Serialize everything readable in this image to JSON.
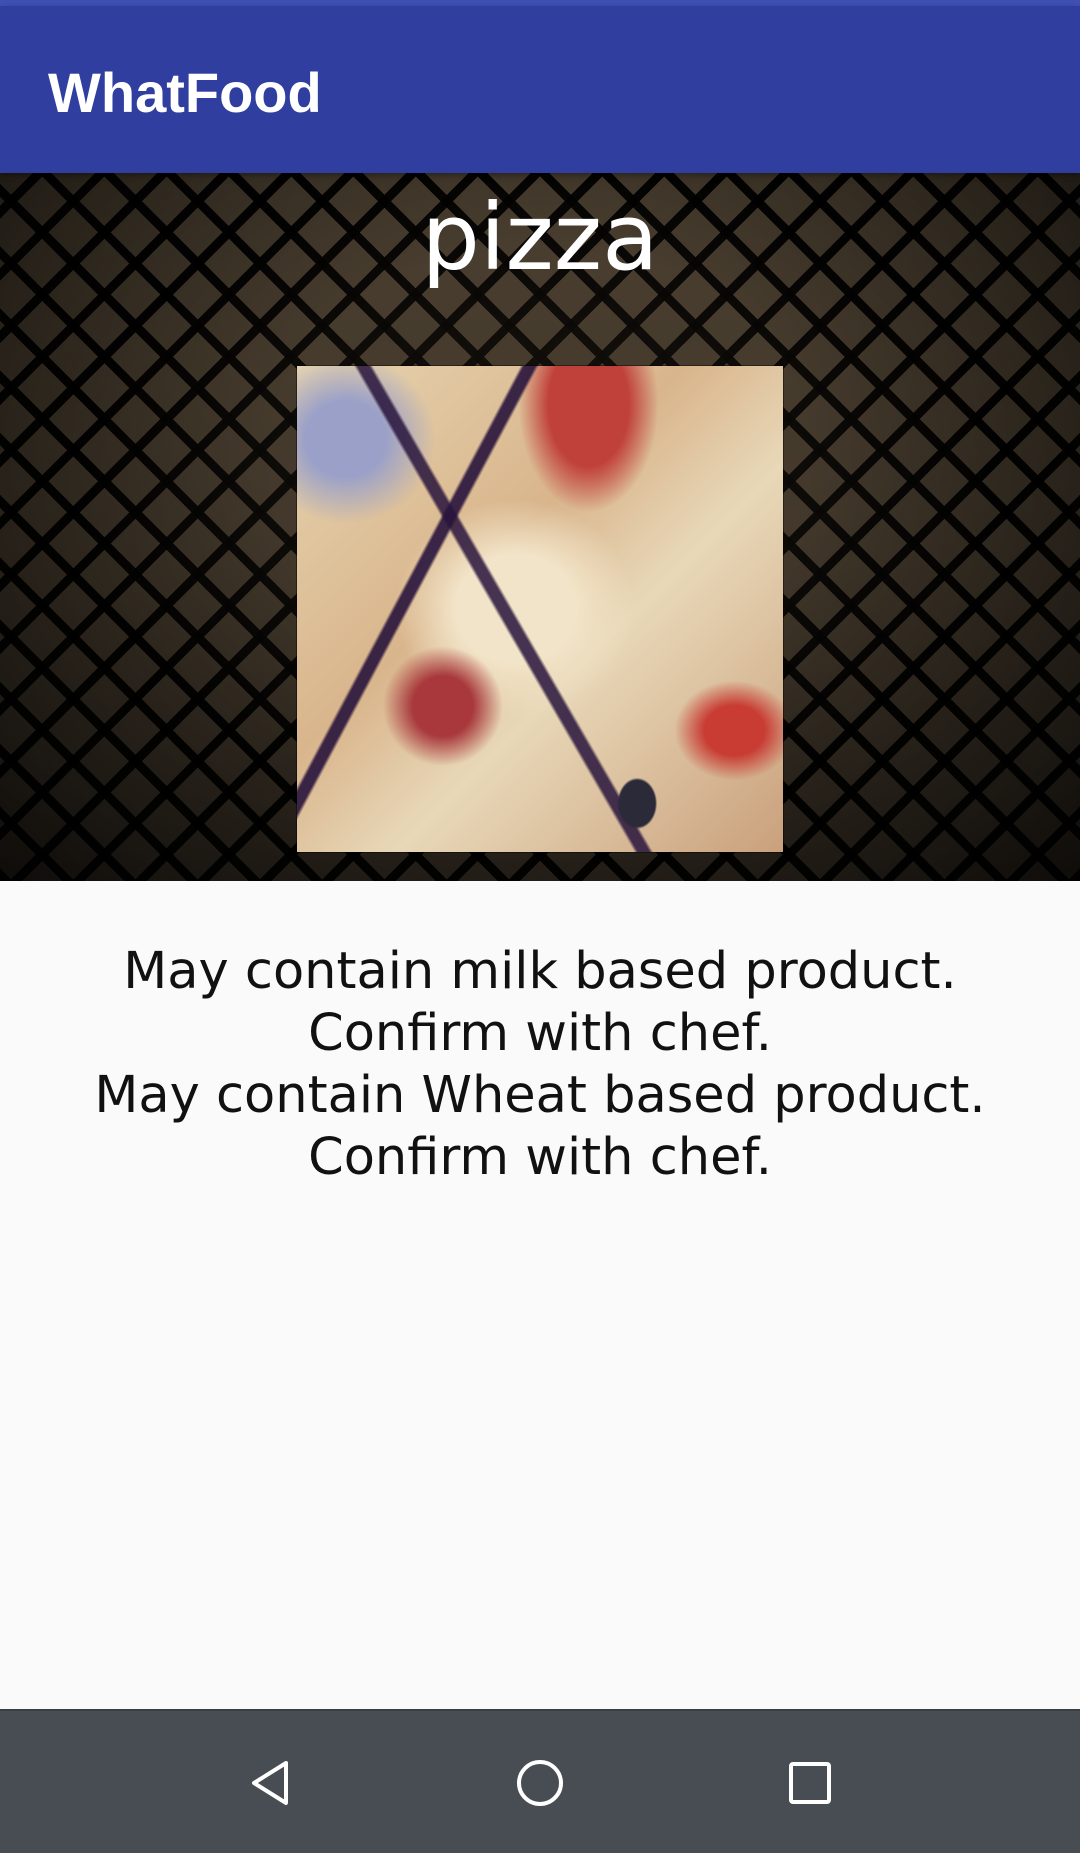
{
  "app_bar": {
    "title": "WhatFood",
    "color": "#303f9f"
  },
  "dish": {
    "name": "pizza",
    "photo": "pizza-photo"
  },
  "allergy_notes": [
    "May contain milk based product.",
    "Confirm with chef.",
    "May contain Wheat based product.",
    "Confirm with chef."
  ],
  "nav_bar": {
    "buttons": [
      "back-icon",
      "home-icon",
      "recents-icon"
    ],
    "color": "#474d52"
  }
}
